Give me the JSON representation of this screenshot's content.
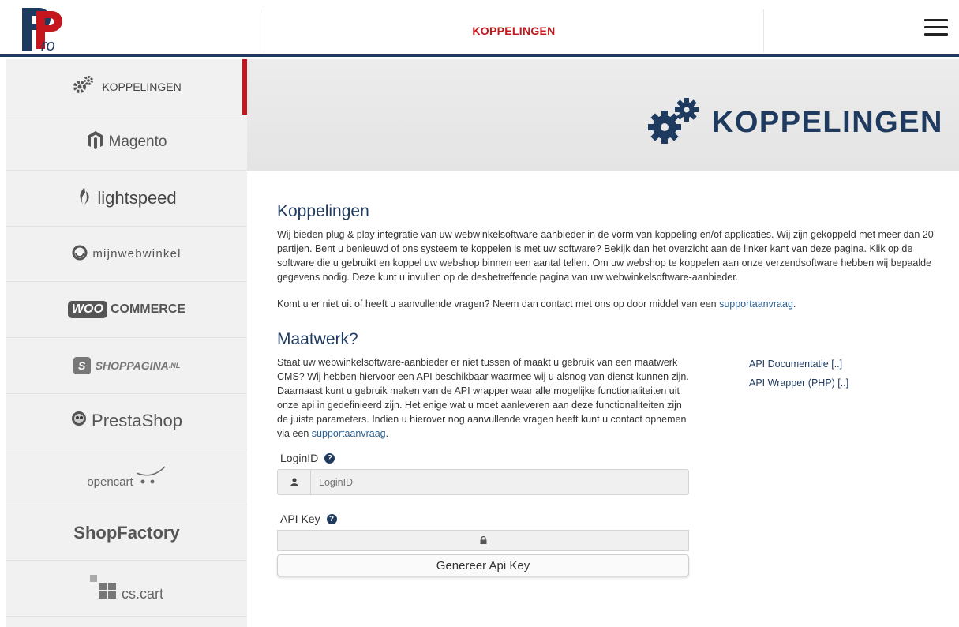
{
  "header": {
    "logo_text": "Pro",
    "title": "KOPPELINGEN",
    "menu_icon": "hamburger-icon"
  },
  "sidebar": {
    "items": [
      {
        "label": "KOPPELINGEN",
        "icon": "gears-icon",
        "active": true
      },
      {
        "label": "Magento",
        "icon": "magento-icon"
      },
      {
        "label": "lightspeed",
        "icon": "lightspeed-icon"
      },
      {
        "label": "mijnwebwinkel",
        "icon": "mijnwebwinkel-icon"
      },
      {
        "label": "COMMERCE",
        "badge": "WOO"
      },
      {
        "label": "SHOPPAGINA",
        "suffix": ".NL",
        "badge": "S"
      },
      {
        "label": "PrestaShop",
        "icon": "prestashop-icon"
      },
      {
        "label": "opencart",
        "icon": "cart-icon"
      },
      {
        "label": "ShopFactory"
      },
      {
        "label": "cs.cart",
        "icon": "cscart-icon"
      }
    ]
  },
  "banner": {
    "title": "KOPPELINGEN",
    "icon": "gears-icon"
  },
  "intro": {
    "heading": "Koppelingen",
    "paragraph": "Wij bieden plug & play integratie van uw webwinkelsoftware-aanbieder in de vorm van koppeling en/of applicaties. Wij zijn gekoppeld met meer dan 20 partijen. Bent u benieuwd of ons systeem te koppelen is met uw software? Bekijk dan het overzicht aan de linker kant van deze pagina. Klik op de software die u gebruikt en koppel uw webshop binnen een aantal tellen. Om uw webshop te koppelen aan onze verzendsoftware hebben wij bepaalde gegevens nodig. Deze kunt u invullen op de desbetreffende pagina van uw webwinkelsoftware-aanbieder.",
    "question_text": "Komt u er niet uit of heeft u aanvullende vragen? Neem dan contact met ons op door middel van een ",
    "question_link": "supportaanvraag",
    "question_end": "."
  },
  "maatwerk": {
    "heading": "Maatwerk?",
    "paragraph": "Staat uw webwinkelsoftware-aanbieder er niet tussen of maakt u gebruik van een maatwerk CMS? Wij hebben hiervoor een API beschikbaar waarmee wij u alsnog van dienst kunnen zijn. Daarnaast kunt u gebruik maken van de API wrapper waar alle mogelijke functionaliteiten uit onze api in gedefinieerd zijn. Het enige wat u moet aanleveren aan deze functionaliteiten zijn de juiste parameters. Indien u hierover nog aanvullende vragen heeft kunt u contact opnemen via een ",
    "link": "supportaanvraag",
    "end": ".",
    "api_doc_link": "API Documentatie [..]",
    "api_wrapper_link": "API Wrapper (PHP) [..]"
  },
  "form": {
    "login_label": "LoginID",
    "login_placeholder": "LoginID",
    "apikey_label": "API Key",
    "apikey_value": "",
    "generate_button": "Genereer Api Key"
  }
}
